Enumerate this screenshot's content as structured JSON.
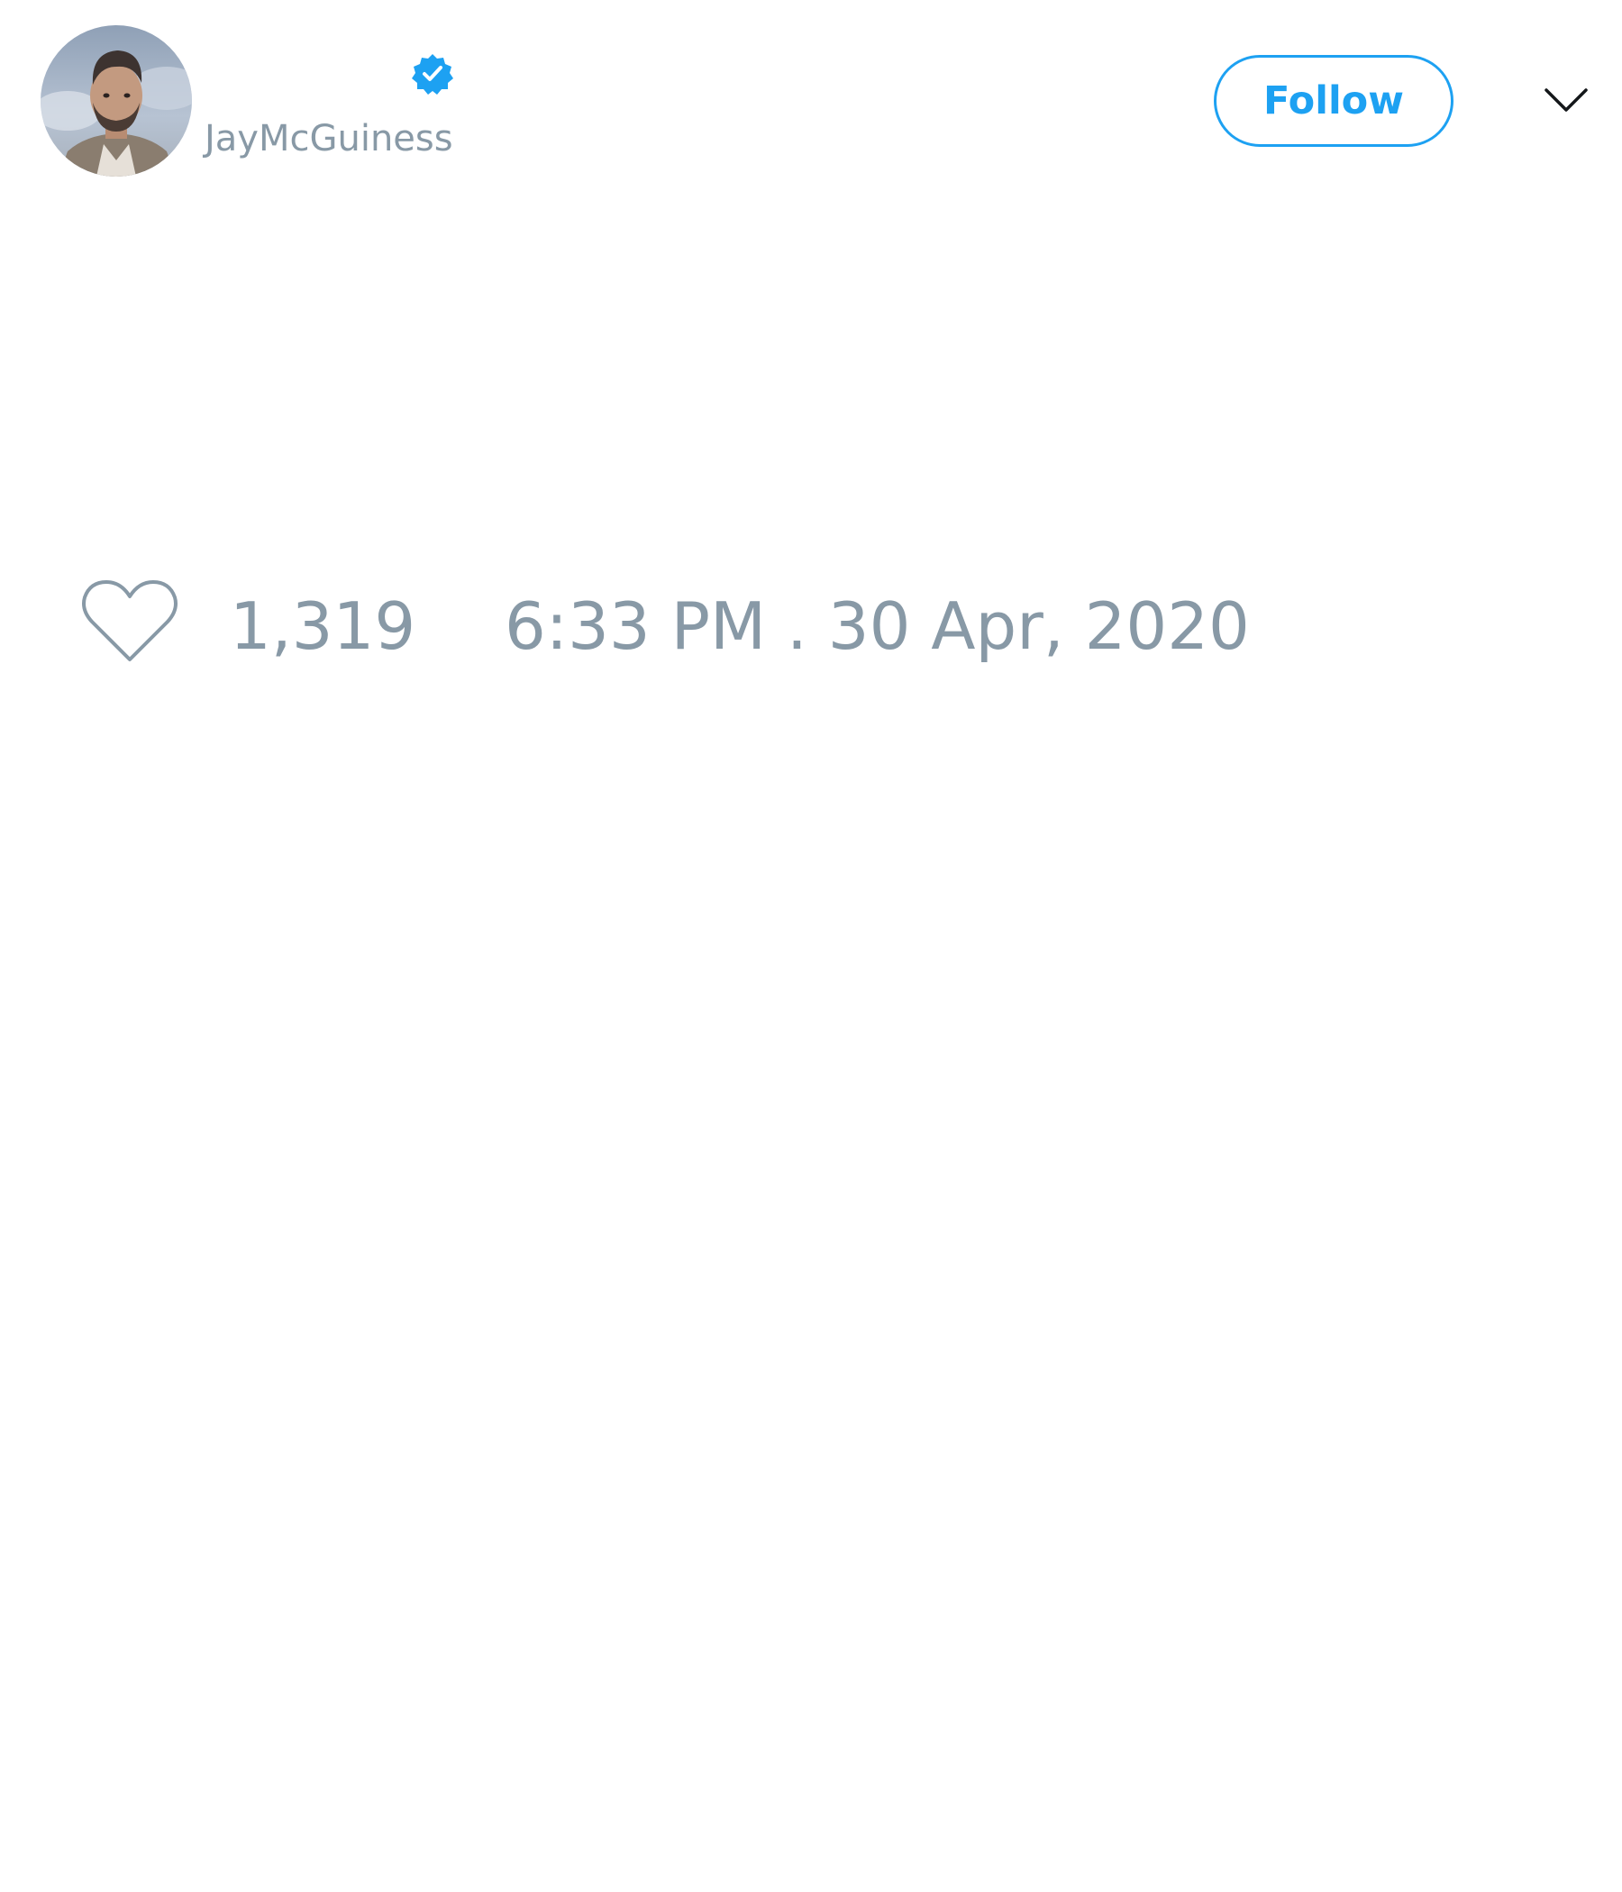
{
  "tweet": {
    "author": {
      "handle": "JayMcGuiness",
      "verified": true,
      "avatar": "profile-photo"
    },
    "follow_label": "Follow",
    "menu_icon": "chevron-down-icon",
    "like_icon": "heart-icon",
    "like_count": "1,319",
    "timestamp": "6:33 PM . 30 Apr, 2020"
  },
  "colors": {
    "accent": "#1da1f2",
    "muted_text": "#8899a6",
    "background": "#ffffff"
  }
}
